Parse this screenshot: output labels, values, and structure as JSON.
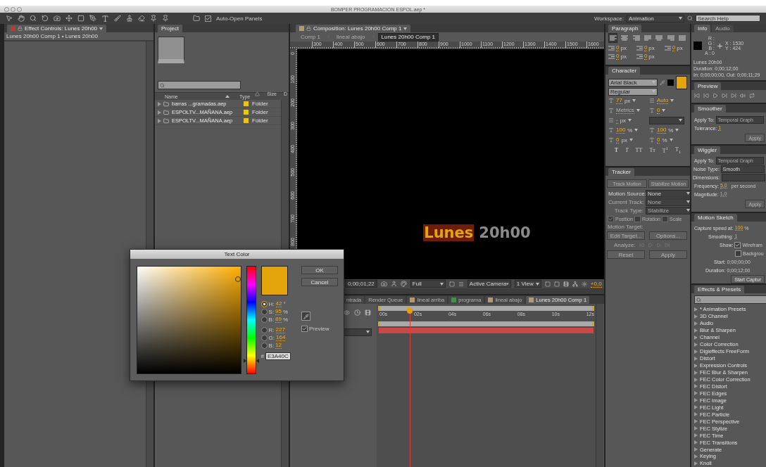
{
  "window": {
    "title": "BOMPER PROGRAMACION ESPOL.aep *"
  },
  "toolbar": {
    "auto_open_panels": {
      "label": "Auto-Open Panels",
      "checked": true
    },
    "workspace": {
      "label": "Workspace:",
      "value": "Animation"
    },
    "search_help": {
      "placeholder": "Search Help"
    }
  },
  "effect_controls": {
    "tab": "Effect Controls: Lunes 20h00",
    "breadcrumb": "Lunes 20h00 Comp 1 • Lunes 20h00"
  },
  "project": {
    "tab": "Project",
    "columns": [
      "Name",
      "Type",
      "Size",
      "D"
    ],
    "rows": [
      {
        "name": "barras ...gramadas.aep",
        "type": "Folder"
      },
      {
        "name": "ESPOLTV...MAÑANA.aep",
        "type": "Folder"
      },
      {
        "name": "ESPOLTV...MAÑANA.aep",
        "type": "Folder"
      }
    ]
  },
  "composition": {
    "tab": "Composition: Lunes 20h00 Comp 1",
    "breadcrumbs": [
      {
        "label": "Comp 1",
        "selected": false
      },
      {
        "label": "lineal abajo",
        "selected": false
      },
      {
        "label": "Lunes 20h00 Comp 1",
        "selected": true
      }
    ],
    "ruler": [
      "300",
      "400",
      "500",
      "600",
      "700",
      "800",
      "900",
      "1000",
      "1100",
      "1200",
      "1300",
      "1400",
      "1500",
      "1600"
    ],
    "vertical_ruler": [
      "0",
      "100",
      "200",
      "300",
      "400",
      "500",
      "600",
      "700",
      "800"
    ],
    "canvas_text": [
      {
        "text": "Lunes",
        "selected": true
      },
      {
        "text": "20h00",
        "selected": false
      }
    ],
    "viewer_bar": {
      "timecode": "0;00;01;22",
      "resolution": "Full",
      "camera": "Active Camera",
      "views": "1 View",
      "exposure": "+0,0"
    }
  },
  "timeline": {
    "tabs": [
      {
        "label": "ntrada",
        "selected": false
      },
      {
        "label": "Render Queue",
        "selected": false
      },
      {
        "label": "lineal arriba",
        "selected": false,
        "color": "#b59a6e"
      },
      {
        "label": "programa",
        "selected": false,
        "color": "#2f9e3a"
      },
      {
        "label": "lineal abajo",
        "selected": false,
        "color": "#b59a6e"
      },
      {
        "label": "Lunes 20h00 Comp 1",
        "selected": true,
        "color": "#b59a6e"
      }
    ],
    "ruler": [
      "00s",
      "02s",
      "04s",
      "06s",
      "08s",
      "10s",
      "12s"
    ]
  },
  "paragraph": {
    "tab": "Paragraph",
    "align_buttons": [
      {
        "selected": true
      },
      {
        "selected": false
      },
      {
        "selected": false
      },
      {
        "selected": false
      },
      {
        "selected": false
      },
      {
        "selected": false
      },
      {
        "selected": false
      }
    ],
    "indents": [
      {
        "value": "0",
        "unit": "px"
      },
      {
        "value": "0",
        "unit": "px"
      },
      {
        "value": "0",
        "unit": "px"
      },
      {
        "value": "0",
        "unit": "px"
      },
      {
        "value": "0",
        "unit": "px"
      }
    ]
  },
  "character": {
    "tab": "Character",
    "font": "Arial Black",
    "style": "Regular",
    "fill": {
      "color": "#e3a40c"
    },
    "rows": [
      [
        {
          "value": "77",
          "unit": "px",
          "disabled": false
        },
        {
          "value": "Auto",
          "disabled": false
        }
      ],
      [
        {
          "value": "Metrics",
          "disabled": true
        },
        {
          "value": "0",
          "disabled": false
        }
      ],
      [
        {
          "value": "-",
          "unit": "px",
          "disabled": false
        }
      ],
      [
        {
          "value": "100",
          "unit": "%",
          "disabled": false
        },
        {
          "value": "100",
          "unit": "%",
          "disabled": false
        }
      ],
      [
        {
          "value": "0",
          "unit": "px",
          "disabled": false
        },
        {
          "value": "0",
          "unit": "%",
          "disabled": false
        }
      ]
    ],
    "styles": [
      {
        "label": "T",
        "kind": "faux-bold"
      },
      {
        "label": "T",
        "kind": "faux-italic"
      },
      {
        "label": "TT",
        "kind": "all-caps"
      },
      {
        "label": "Tт",
        "kind": "small-caps"
      },
      {
        "label": "T$^{1}$",
        "kind": "superscript"
      },
      {
        "label": "T$_{1}$",
        "kind": "subscript"
      }
    ]
  },
  "tracker": {
    "tab": "Tracker",
    "buttons": [
      {
        "label": "Track Motion",
        "disabled": true
      },
      {
        "label": "Stabilize Motion",
        "disabled": true
      }
    ],
    "fields": [
      {
        "label": "Motion Source:",
        "value": "None",
        "disabled": false
      },
      {
        "label": "Current Track:",
        "value": "None",
        "disabled": true
      },
      {
        "label": "Track Type:",
        "value": "Stabilize",
        "disabled": true
      }
    ],
    "checkboxes": [
      {
        "label": "Position",
        "checked": true
      },
      {
        "label": "Rotation",
        "checked": false
      },
      {
        "label": "Scale",
        "checked": false
      }
    ],
    "motion_target": "Motion Target:",
    "target_buttons": [
      {
        "label": "Edit Target...",
        "disabled": true
      },
      {
        "label": "Options...",
        "disabled": true
      }
    ],
    "analyze": "Analyze:",
    "bottom_buttons": [
      {
        "label": "Reset",
        "disabled": true
      },
      {
        "label": "Apply",
        "disabled": true
      }
    ]
  },
  "info": {
    "tabs": [
      {
        "label": "Info",
        "selected": true
      },
      {
        "label": "Audio",
        "selected": false
      }
    ],
    "channels": [
      "R :",
      "G :",
      "B :",
      "A : 0"
    ],
    "x": "X : 1530",
    "y": "Y : 424",
    "lines": [
      "Lunes 20h00",
      "Duration: 0;00;12;00",
      "In: 0;00;00;00, Out: 0;00;11;29"
    ]
  },
  "preview": {
    "tab": "Preview"
  },
  "smoother": {
    "tab": "Smoother",
    "apply_to": {
      "label": "Apply To:",
      "value": "Temporal Graph"
    },
    "tolerance": {
      "label": "Tolerance:",
      "value": "1"
    },
    "apply": "Apply"
  },
  "wiggler": {
    "tab": "Wiggler",
    "apply_to": {
      "label": "Apply To:",
      "value": "Temporal Graph"
    },
    "noise_type": {
      "label": "Noise Type:",
      "value": "Smooth"
    },
    "dimensions": {
      "label": "Dimensions:"
    },
    "frequency": {
      "label": "Frequency:",
      "value": "5,0",
      "unit": "per second"
    },
    "magnitude": {
      "label": "Magnitude:",
      "value": "1,0"
    },
    "apply": "Apply"
  },
  "motion_sketch": {
    "tab": "Motion Sketch",
    "capture_speed": {
      "label": "Capture speed at:",
      "value": "100",
      "unit": "%"
    },
    "smoothing": {
      "label": "Smoothing:",
      "value": "1"
    },
    "show": "Show:",
    "options": [
      {
        "label": "Wirefram",
        "checked": true
      },
      {
        "label": "Backgrou",
        "checked": false
      }
    ],
    "start": {
      "label": "Start:",
      "value": "0;00;00;00"
    },
    "duration": {
      "label": "Duration:",
      "value": "0;00;12;00"
    },
    "button": "Start Captur"
  },
  "effects": {
    "tab": "Effects & Presets",
    "items": [
      "* Animation Presets",
      "3D Channel",
      "Audio",
      "Blur & Sharpen",
      "Channel",
      "Color Correction",
      "Digieffects FreeForm",
      "Distort",
      "Expression Controls",
      "FEC Blur & Sharpen",
      "FEC Color Correction",
      "FEC Distort",
      "FEC Edges",
      "FEC Image",
      "FEC Light",
      "FEC Particle",
      "FEC Perspective",
      "FEC Stylize",
      "FEC Time",
      "FEC Transitions",
      "Generate",
      "Keying",
      "Knoll"
    ]
  },
  "dialog": {
    "title": "Text Color",
    "ok": "OK",
    "cancel": "Cancel",
    "components": [
      {
        "label": "H:",
        "value": "42",
        "unit": "°",
        "selected": true
      },
      {
        "label": "S:",
        "value": "95",
        "unit": "%",
        "selected": false
      },
      {
        "label": "B:",
        "value": "89",
        "unit": "%",
        "selected": false
      },
      {
        "label": "R:",
        "value": "227",
        "selected": false
      },
      {
        "label": "G:",
        "value": "164",
        "selected": false
      },
      {
        "label": "B:",
        "value": "12",
        "selected": false
      }
    ],
    "hue": {
      "level": 0.12
    },
    "hash": "#",
    "hex": "E3A40C",
    "preview": {
      "label": "Preview",
      "checked": true
    }
  }
}
